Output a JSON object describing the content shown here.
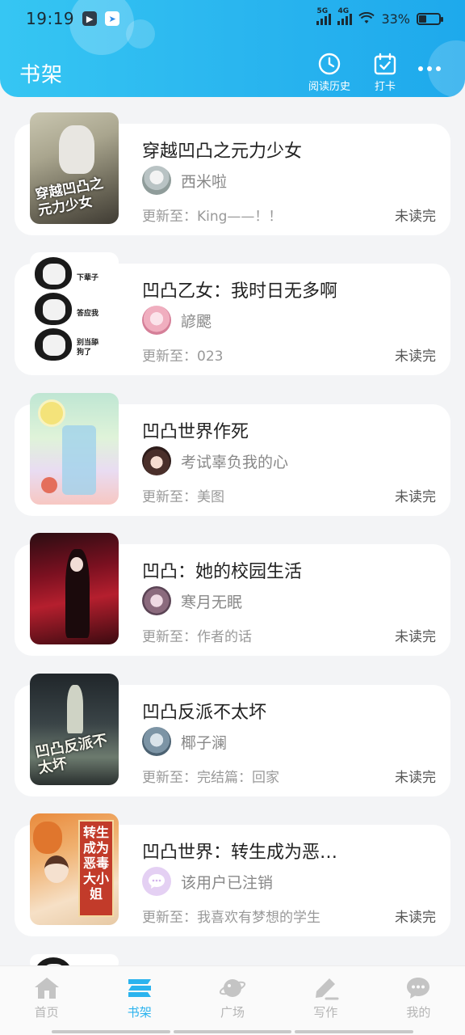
{
  "status_bar": {
    "time": "19:19",
    "net1": "5G",
    "net2": "4G",
    "battery_pct": "33%",
    "battery_level": 0.33
  },
  "header": {
    "title": "书架",
    "history_label": "阅读历史",
    "checkin_label": "打卡"
  },
  "books": [
    {
      "title": "穿越凹凸之元力少女",
      "author": "西米啦",
      "update": "更新至：King——！！",
      "status": "未读完",
      "cover_text": "穿越凹凸之元力少女"
    },
    {
      "title": "凹凸乙女：我时日无多啊",
      "author": "諺颸",
      "update": "更新至：023",
      "status": "未读完",
      "cover_text_1": "下辈子",
      "cover_text_2": "答应我",
      "cover_text_3": "别当舔狗了"
    },
    {
      "title": "凹凸世界作死",
      "author": "考试辜负我的心",
      "update": "更新至：美图",
      "status": "未读完"
    },
    {
      "title": "凹凸：她的校园生活",
      "author": "寒月无眠",
      "update": "更新至：作者的话",
      "status": "未读完"
    },
    {
      "title": "凹凸反派不太坏",
      "author": "椰子澜",
      "update": "更新至：完结篇：回家",
      "status": "未读完",
      "cover_text": "凹凸反派不太坏"
    },
    {
      "title": "凹凸世界：转生成为恶…",
      "author": "该用户已注销",
      "update": "更新至：我喜欢有梦想的学生",
      "status": "未读完",
      "cover_text": "转生成为恶毒大小姐"
    }
  ],
  "nav": [
    {
      "label": "首页",
      "icon": "home-icon"
    },
    {
      "label": "书架",
      "icon": "bookshelf-icon"
    },
    {
      "label": "广场",
      "icon": "planet-icon"
    },
    {
      "label": "写作",
      "icon": "pen-icon"
    },
    {
      "label": "我的",
      "icon": "chat-bubble-icon"
    }
  ],
  "colors": {
    "accent": "#2bb3ee",
    "header_start": "#36c6f3",
    "header_end": "#1ea9ec"
  }
}
